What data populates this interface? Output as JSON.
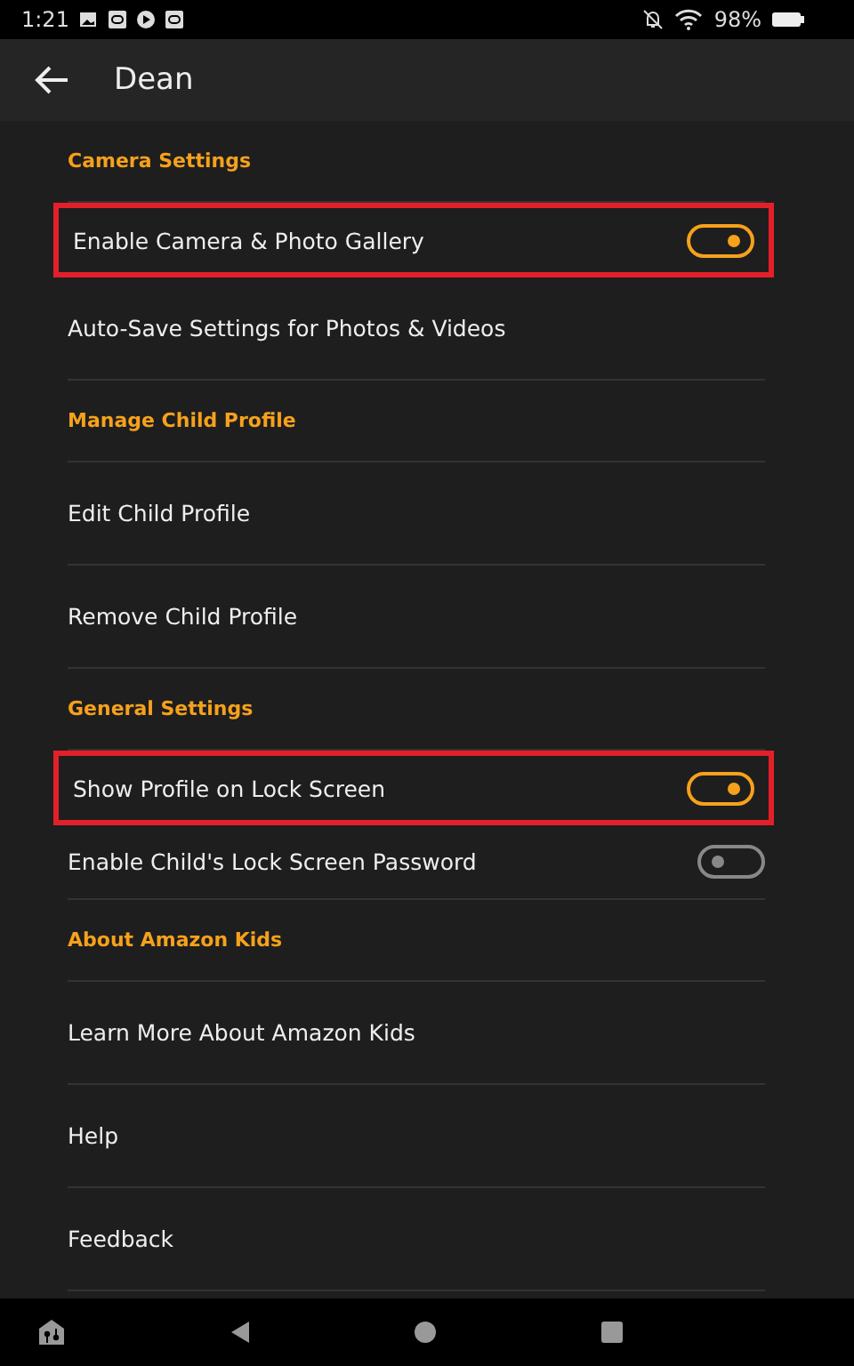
{
  "status_bar": {
    "time": "1:21",
    "battery": "98%"
  },
  "header": {
    "title": "Dean"
  },
  "items": [
    {
      "kind": "section",
      "label": "Camera Settings"
    },
    {
      "kind": "toggle",
      "label": "Enable Camera & Photo Gallery",
      "on": true,
      "highlighted": true
    },
    {
      "kind": "link",
      "label": "Auto-Save Settings for Photos & Videos"
    },
    {
      "kind": "section",
      "label": "Manage Child Profile"
    },
    {
      "kind": "link",
      "label": "Edit Child Profile"
    },
    {
      "kind": "link",
      "label": "Remove Child Profile"
    },
    {
      "kind": "section",
      "label": "General Settings"
    },
    {
      "kind": "toggle",
      "label": "Show Profile on Lock Screen",
      "on": true,
      "highlighted": true
    },
    {
      "kind": "toggle",
      "label": "Enable Child's Lock Screen Password",
      "on": false,
      "highlighted": false
    },
    {
      "kind": "section",
      "label": "About Amazon Kids"
    },
    {
      "kind": "link",
      "label": "Learn More About Amazon Kids"
    },
    {
      "kind": "link",
      "label": "Help"
    },
    {
      "kind": "link",
      "label": "Feedback"
    }
  ]
}
